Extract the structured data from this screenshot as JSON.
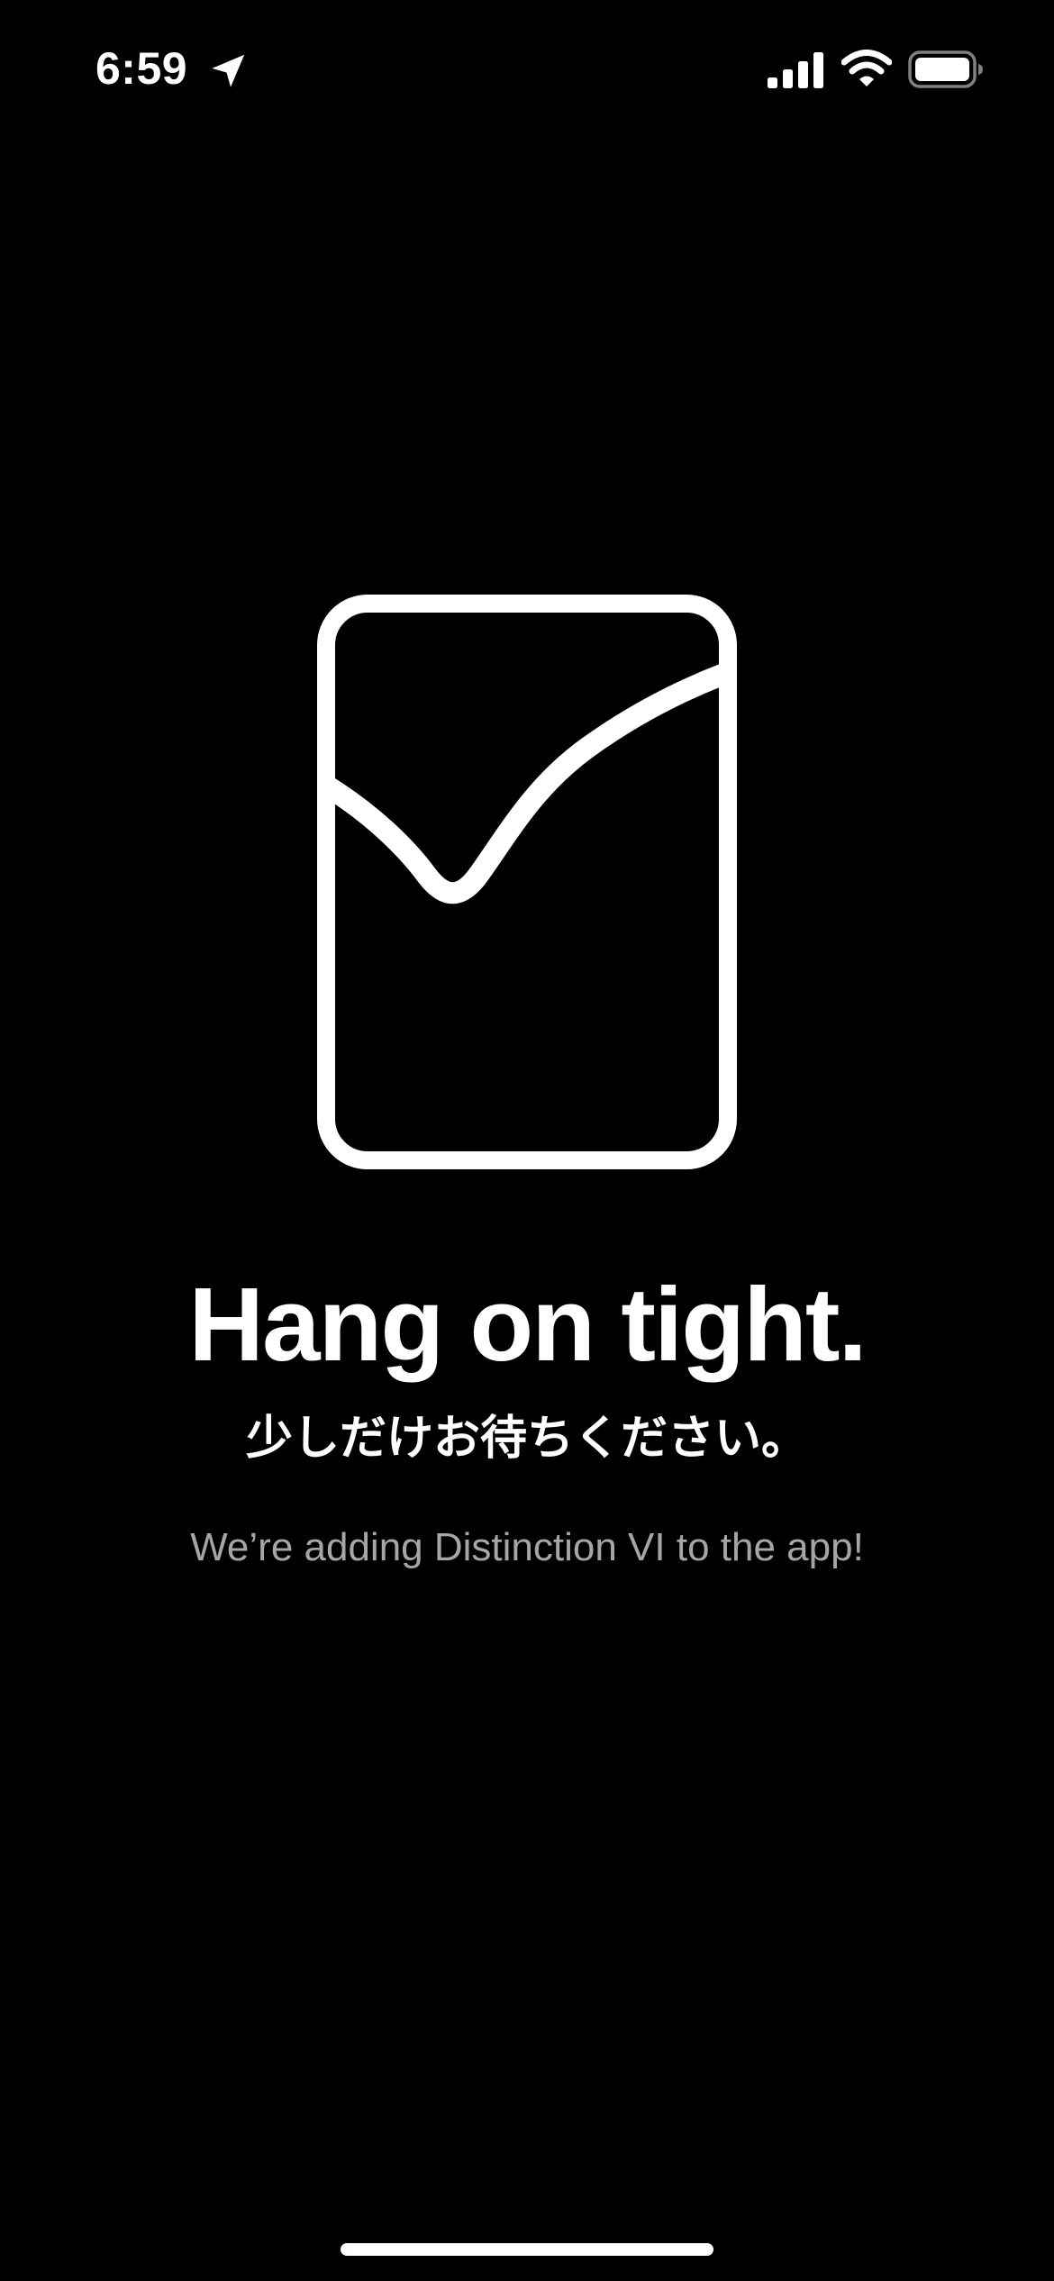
{
  "status_bar": {
    "time": "6:59",
    "icons": [
      "location-arrow-icon",
      "cellular-signal-icon",
      "wifi-icon",
      "battery-icon"
    ]
  },
  "illustration": {
    "icon": "card-check-icon"
  },
  "main": {
    "headline": "Hang on tight.",
    "subheadline_jp": "少しだけお待ちください。",
    "info": "We’re adding Distinction VI to the app!"
  },
  "colors": {
    "background": "#000000",
    "primary_text": "#ffffff",
    "secondary_text": "#a6a6a6"
  }
}
